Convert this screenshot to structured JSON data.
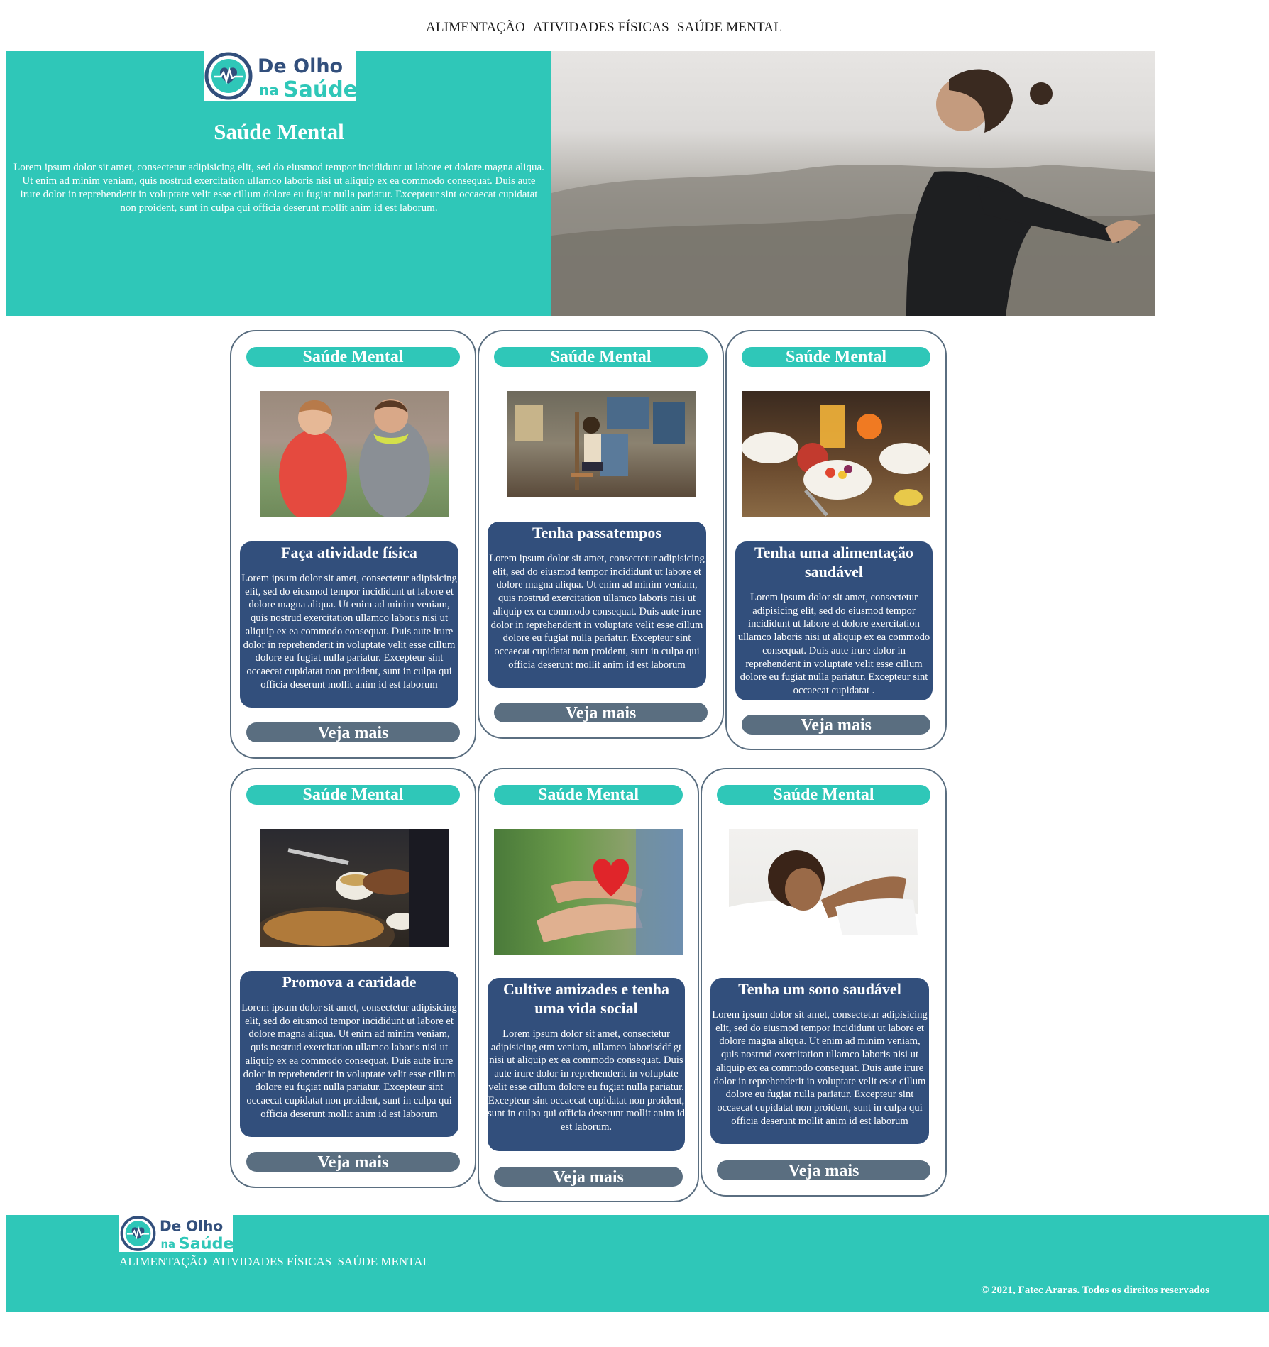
{
  "nav": {
    "items": [
      "ALIMENTAÇÃO",
      "ATIVIDADES FÍSICAS",
      "SAÚDE MENTAL"
    ]
  },
  "brand": {
    "logo_line1": "De Olho",
    "logo_line2a": "na",
    "logo_line2b": "Saúde",
    "teal": "#2fc7b8",
    "navy": "#324f7c",
    "slate": "#5a6e80"
  },
  "hero": {
    "title": "Saúde Mental",
    "text": "Lorem ipsum dolor sit amet, consectetur adipisicing elit, sed do eiusmod tempor incididunt ut labore et dolore magna aliqua. Ut enim ad minim veniam, quis nostrud exercitation ullamco laboris nisi ut aliquip ex ea commodo consequat. Duis aute irure dolor in reprehenderit in voluptate velit esse cillum dolore eu fugiat nulla pariatur. Excepteur sint occaecat cupidatat non proident, sunt in culpa qui officia deserunt mollit anim id est laborum.",
    "image": "man-arms-open-mountain-photo"
  },
  "cards": [
    {
      "category": "Saúde Mental",
      "image": "couple-jogging-photo",
      "title": "Faça atividade física",
      "text": "Lorem ipsum dolor sit amet, consectetur adipisicing elit, sed do eiusmod tempor incididunt ut labore et dolore magna aliqua. Ut enim ad minim veniam, quis nostrud exercitation ullamco laboris nisi ut aliquip ex ea commodo consequat. Duis aute irure dolor in reprehenderit in voluptate velit esse cillum dolore eu fugiat nulla pariatur. Excepteur sint occaecat cupidatat non proident, sunt in culpa qui officia deserunt mollit anim id est laborum",
      "button": "Veja mais"
    },
    {
      "category": "Saúde Mental",
      "image": "painting-easel-photo",
      "title": "Tenha passatempos",
      "text": "Lorem ipsum dolor sit amet, consectetur adipisicing elit, sed do eiusmod tempor incididunt ut labore et dolore magna aliqua. Ut enim ad minim veniam, quis nostrud exercitation ullamco laboris nisi ut aliquip ex ea commodo consequat. Duis aute irure dolor in reprehenderit in voluptate velit esse cillum dolore eu fugiat nulla pariatur. Excepteur sint occaecat cupidatat non proident, sunt in culpa qui officia deserunt mollit anim id est laborum",
      "button": "Veja mais"
    },
    {
      "category": "Saúde Mental",
      "image": "healthy-breakfast-photo",
      "title": "Tenha uma alimentação saudável",
      "text": "Lorem ipsum dolor sit amet, consectetur adipisicing elit, sed do eiusmod tempor incididunt ut labore et dolore exercitation ullamco laboris nisi ut aliquip ex ea commodo consequat. Duis aute irure dolor in reprehenderit in voluptate velit esse cillum dolore eu fugiat nulla pariatur. Excepteur sint occaecat cupidatat .",
      "button": "Veja mais"
    },
    {
      "category": "Saúde Mental",
      "image": "charity-soup-serving-photo",
      "title": "Promova a caridade",
      "text": "Lorem ipsum dolor sit amet, consectetur adipisicing elit, sed do eiusmod tempor incididunt ut labore et dolore magna aliqua. Ut enim ad minim veniam, quis nostrud exercitation ullamco laboris nisi ut aliquip ex ea commodo consequat. Duis aute irure dolor in reprehenderit in voluptate velit esse cillum dolore eu fugiat nulla pariatur. Excepteur sint occaecat cupidatat non proident, sunt in culpa qui officia deserunt mollit anim id est laborum",
      "button": "Veja mais"
    },
    {
      "category": "Saúde Mental",
      "image": "hands-holding-heart-photo",
      "title": "Cultive amizades e tenha uma vida social",
      "text": "Lorem ipsum dolor sit amet, consectetur adipisicing etm veniam, ullamco laborisddf gt nisi ut aliquip ex ea commodo consequat. Duis aute irure dolor in reprehenderit in voluptate velit esse cillum dolore eu fugiat nulla pariatur. Excepteur sint occaecat cupidatat non proident, sunt in culpa qui officia deserunt mollit anim id est laborum.",
      "button": "Veja mais"
    },
    {
      "category": "Saúde Mental",
      "image": "woman-sleeping-photo",
      "title": "Tenha um sono saudável",
      "text": "Lorem ipsum dolor sit amet, consectetur adipisicing elit, sed do eiusmod tempor incididunt ut labore et dolore magna aliqua. Ut enim ad minim veniam, quis nostrud exercitation ullamco laboris nisi ut aliquip ex ea commodo consequat. Duis aute irure dolor in reprehenderit in voluptate velit esse cillum dolore eu fugiat nulla pariatur. Excepteur sint occaecat cupidatat non proident, sunt in culpa qui officia deserunt mollit anim id est laborum",
      "button": "Veja mais"
    }
  ],
  "footer": {
    "nav": [
      "ALIMENTAÇÃO",
      "ATIVIDADES FÍSICAS",
      "SAÚDE MENTAL"
    ],
    "copyright": "© 2021, Fatec Araras. Todos os direitos reservados"
  }
}
